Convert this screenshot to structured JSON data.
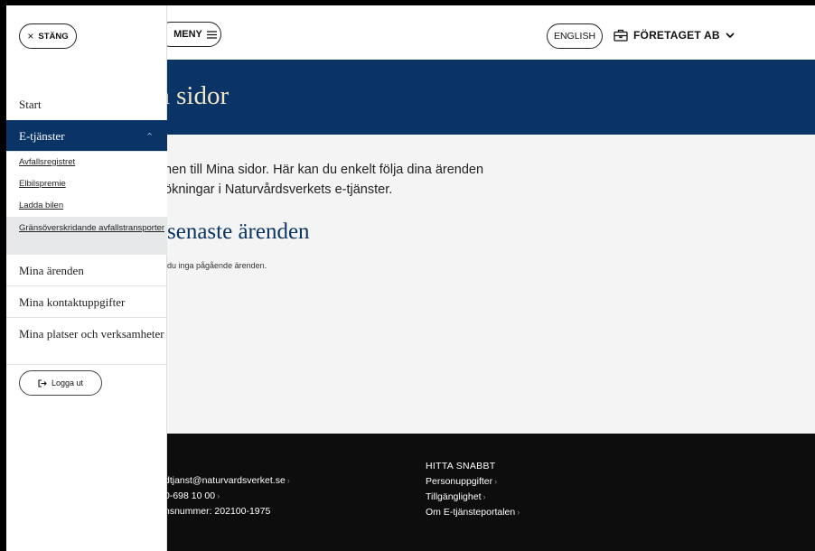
{
  "drawer": {
    "close_label": "STÄNG",
    "close_icon": "×",
    "nav": {
      "start": "Start",
      "etjanster": "E-tjänster",
      "sub_items": [
        "Avfallsregistret",
        "Elbilspremie",
        "Ladda bilen",
        "Gränsöverskridande avfallstransporter"
      ],
      "mina_arenden": "Mina ärenden",
      "kontaktuppgifter": "Mina kontaktuppgifter",
      "platser": "Mina platser och verksamheter"
    },
    "logout_label": "Logga ut"
  },
  "header": {
    "menu_label": "MENY",
    "english_label": "ENGLISH",
    "company_label": "FÖRETAGET AB"
  },
  "hero": {
    "title_fragment": "a sidor"
  },
  "main": {
    "intro_line1": "nen till Mina sidor. Här kan du enkelt följa dina ärenden",
    "intro_line2": "ökningar i Naturvårdsverkets e-tjänster.",
    "section_heading": "senaste ärenden",
    "empty_text": "du inga pågående ärenden."
  },
  "footer": {
    "contact_email": "dtjanst@naturvardsverket.se",
    "contact_phone": "0-698 10 00",
    "org_number": "nsnummer: 202100-1975",
    "quick_heading": "HITTA SNABBT",
    "quick_links": [
      "Personuppgifter",
      "Tillgänglighet",
      "Om E-tjänsteportalen"
    ]
  },
  "colors": {
    "navy": "#0a3466",
    "hero_title": "#f2e6c8",
    "footer_bg": "#0d0d0d"
  }
}
